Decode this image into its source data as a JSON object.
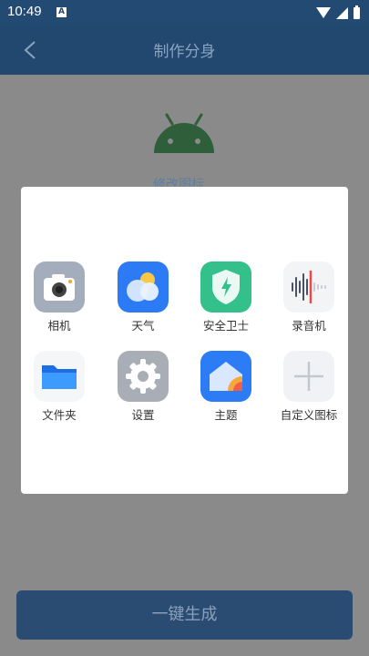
{
  "status_bar": {
    "time": "10:49",
    "notification": "A"
  },
  "header": {
    "title": "制作分身"
  },
  "main": {
    "modify_label": "修改图标",
    "generate_label": "一键生成"
  },
  "dialog": {
    "apps": [
      {
        "label": "相机",
        "icon": "camera-icon"
      },
      {
        "label": "天气",
        "icon": "weather-icon"
      },
      {
        "label": "安全卫士",
        "icon": "security-icon"
      },
      {
        "label": "录音机",
        "icon": "recorder-icon"
      },
      {
        "label": "文件夹",
        "icon": "folder-icon"
      },
      {
        "label": "设置",
        "icon": "settings-icon"
      },
      {
        "label": "主题",
        "icon": "theme-icon"
      },
      {
        "label": "自定义图标",
        "icon": "add-icon"
      }
    ]
  },
  "colors": {
    "header_bg": "#23486f",
    "dialog_bg": "#ffffff",
    "overlay": "#8a8a8a"
  }
}
